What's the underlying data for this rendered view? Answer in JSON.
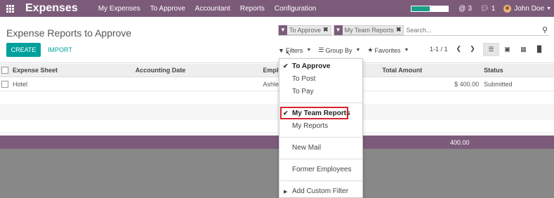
{
  "app": {
    "name": "Expenses",
    "menu": [
      "My Expenses",
      "To Approve",
      "Accountant",
      "Reports",
      "Configuration"
    ],
    "progress_fraction": 0.5,
    "mentions_count": "3",
    "messages_count": "1",
    "user_name": "John Doe"
  },
  "control": {
    "title": "Expense Reports to Approve",
    "facets": [
      "To Approve",
      "My Team Reports"
    ],
    "search_placeholder": "Search...",
    "create_label": "CREATE",
    "import_label": "IMPORT",
    "filters_label": "Filters",
    "groupby_label": "Group By",
    "favorites_label": "Favorites",
    "pager": "1-1 / 1"
  },
  "list": {
    "columns": [
      "Expense Sheet",
      "Accounting Date",
      "Employ",
      "Total Amount",
      "Status"
    ],
    "rows": [
      {
        "sheet": "Hotel",
        "date": "",
        "employee": "Ashley",
        "amount": "$ 400.00",
        "status": "Submitted"
      }
    ],
    "footer_total": "400.00"
  },
  "filters_dropdown": {
    "items": [
      {
        "label": "To Approve",
        "checked": true
      },
      {
        "label": "To Post",
        "checked": false
      },
      {
        "label": "To Pay",
        "checked": false
      },
      {
        "label": "My Team Reports",
        "checked": true
      },
      {
        "label": "My Reports",
        "checked": false
      },
      {
        "label": "New Mail",
        "checked": false
      },
      {
        "label": "Former Employees",
        "checked": false
      },
      {
        "label": "Add Custom Filter",
        "checked": false
      }
    ]
  },
  "colors": {
    "brand": "#7c5b7a",
    "accent": "#00a09d",
    "highlight": "#d9232e"
  }
}
